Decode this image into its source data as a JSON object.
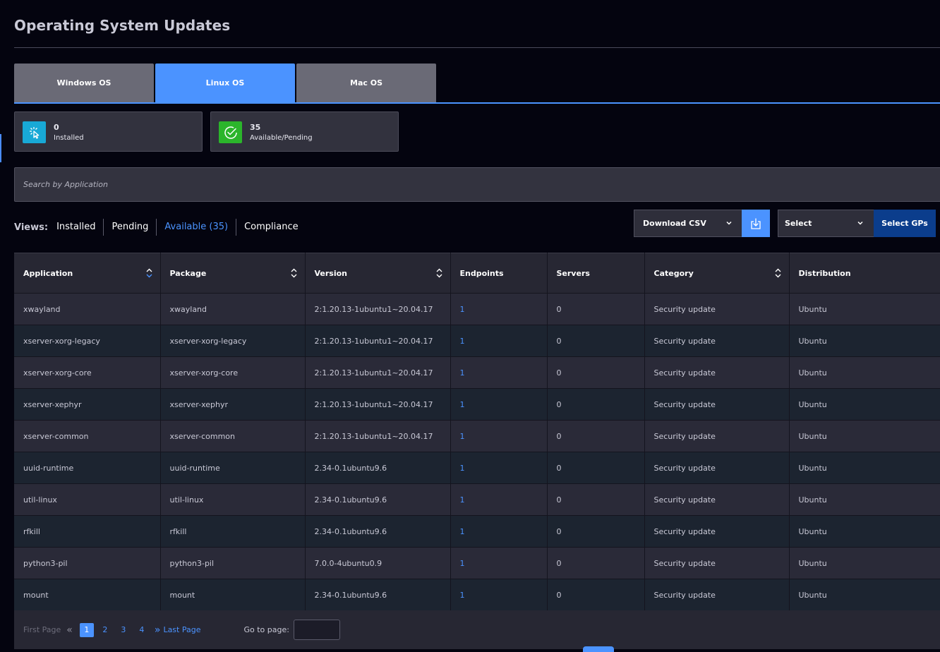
{
  "page": {
    "title": "Operating System Updates"
  },
  "os_tabs": [
    {
      "label": "Windows OS",
      "active": false
    },
    {
      "label": "Linux OS",
      "active": true
    },
    {
      "label": "Mac OS",
      "active": false
    }
  ],
  "stats": {
    "installed": {
      "count": "0",
      "label": "Installed",
      "icon": "cursor-click-icon",
      "color": "#18a9d6"
    },
    "available": {
      "count": "35",
      "label": "Available/Pending",
      "icon": "check-circle-icon",
      "color": "#2bb52b"
    }
  },
  "search": {
    "placeholder": "Search by Application",
    "value": ""
  },
  "views": {
    "label": "Views:",
    "items": [
      {
        "label": "Installed",
        "active": false
      },
      {
        "label": "Pending",
        "active": false
      },
      {
        "label": "Available (35)",
        "active": true
      },
      {
        "label": "Compliance",
        "active": false
      }
    ]
  },
  "toolbar": {
    "download_select": "Download CSV",
    "download_icon": "download-icon",
    "gp_select": "Select",
    "gp_button": "Select GPs"
  },
  "table": {
    "columns": [
      "Application",
      "Package",
      "Version",
      "Endpoints",
      "Servers",
      "Category",
      "Distribution"
    ],
    "rows": [
      [
        "xwayland",
        "xwayland",
        "2:1.20.13-1ubuntu1~20.04.17",
        "1",
        "0",
        "Security update",
        "Ubuntu"
      ],
      [
        "xserver-xorg-legacy",
        "xserver-xorg-legacy",
        "2:1.20.13-1ubuntu1~20.04.17",
        "1",
        "0",
        "Security update",
        "Ubuntu"
      ],
      [
        "xserver-xorg-core",
        "xserver-xorg-core",
        "2:1.20.13-1ubuntu1~20.04.17",
        "1",
        "0",
        "Security update",
        "Ubuntu"
      ],
      [
        "xserver-xephyr",
        "xserver-xephyr",
        "2:1.20.13-1ubuntu1~20.04.17",
        "1",
        "0",
        "Security update",
        "Ubuntu"
      ],
      [
        "xserver-common",
        "xserver-common",
        "2:1.20.13-1ubuntu1~20.04.17",
        "1",
        "0",
        "Security update",
        "Ubuntu"
      ],
      [
        "uuid-runtime",
        "uuid-runtime",
        "2.34-0.1ubuntu9.6",
        "1",
        "0",
        "Security update",
        "Ubuntu"
      ],
      [
        "util-linux",
        "util-linux",
        "2.34-0.1ubuntu9.6",
        "1",
        "0",
        "Security update",
        "Ubuntu"
      ],
      [
        "rfkill",
        "rfkill",
        "2.34-0.1ubuntu9.6",
        "1",
        "0",
        "Security update",
        "Ubuntu"
      ],
      [
        "python3-pil",
        "python3-pil",
        "7.0.0-4ubuntu0.9",
        "1",
        "0",
        "Security update",
        "Ubuntu"
      ],
      [
        "mount",
        "mount",
        "2.34-0.1ubuntu9.6",
        "1",
        "0",
        "Security update",
        "Ubuntu"
      ]
    ]
  },
  "pagination": {
    "first_label": "First Page",
    "pages": [
      "1",
      "2",
      "3",
      "4"
    ],
    "current": "1",
    "last_label": "Last Page",
    "goto_label": "Go to page:",
    "goto_value": ""
  },
  "colors": {
    "accent": "#4b93ff",
    "background": "#04040f",
    "brand_dark": "#0b3d8c"
  }
}
